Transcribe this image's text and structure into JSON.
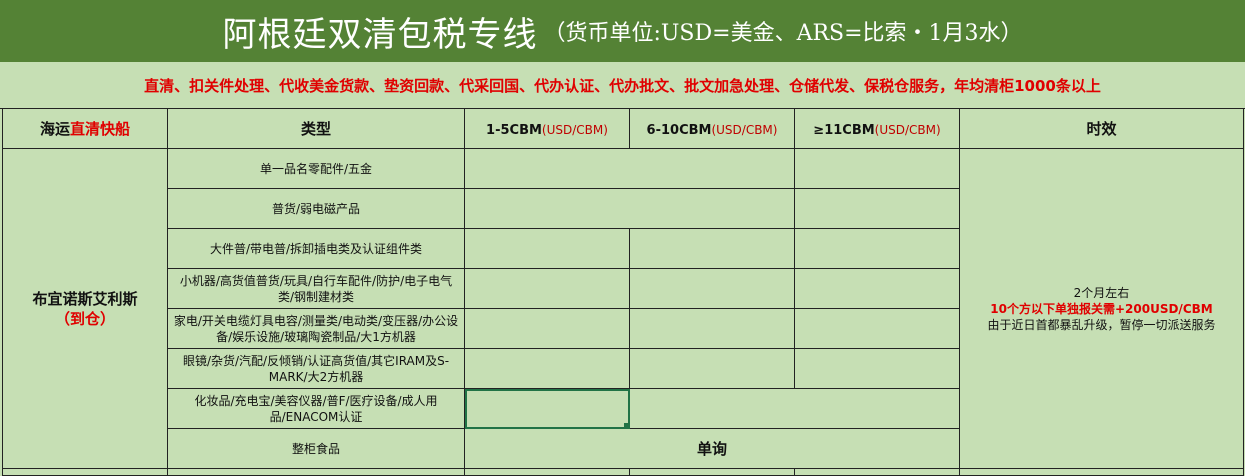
{
  "title": {
    "main": "阿根廷双清包税专线",
    "sub": "（货币单位:USD=美金、ARS=比索・1月3水）"
  },
  "services": "直清、扣关件处理、代收美金货款、垫资回款、代采回国、代办认证、代办批文、批文加急处理、仓储代发、保税仓服务，年均清柜1000条以上",
  "header": {
    "route_prefix": "海运",
    "route_highlight": "直清快船",
    "type": "类型",
    "tier1_label": "1-5CBM",
    "tier2_label": "6-10CBM",
    "tier3_label": "≥11CBM",
    "cbm_unit": "(USD/CBM)",
    "timeline": "时效"
  },
  "destination": {
    "city": "布宜诺斯艾利斯",
    "note": "（到仓）"
  },
  "categories": [
    "单一品名零配件/五金",
    "普货/弱电磁产品",
    "大件普/带电普/拆卸插电类及认证组件类",
    "小机器/高货值普货/玩具/自行车配件/防护/电子电气类/钢制建材类",
    "家电/开关电缆灯具电容/测量类/电动类/变压器/办公设备/娱乐设施/玻璃陶瓷制品/大1方机器",
    "眼镜/杂货/汽配/反倾销/认证高货值/其它IRAM及S-MARK/大2方机器",
    "化妆品/充电宝/美容仪器/普F/医疗设备/成人用品/ENACOM认证",
    "整柜食品"
  ],
  "inquire": "单询",
  "timeline": {
    "duration": "2个月左右",
    "surcharge": "10个方以下单独报关需+200USD/CBM",
    "notice": "由于近日首都暴乱升级，暂停一切派送服务"
  },
  "colors": {
    "title_bg": "#548235",
    "sheet_bg": "#c6dfb4",
    "accent_red": "#e00000"
  }
}
